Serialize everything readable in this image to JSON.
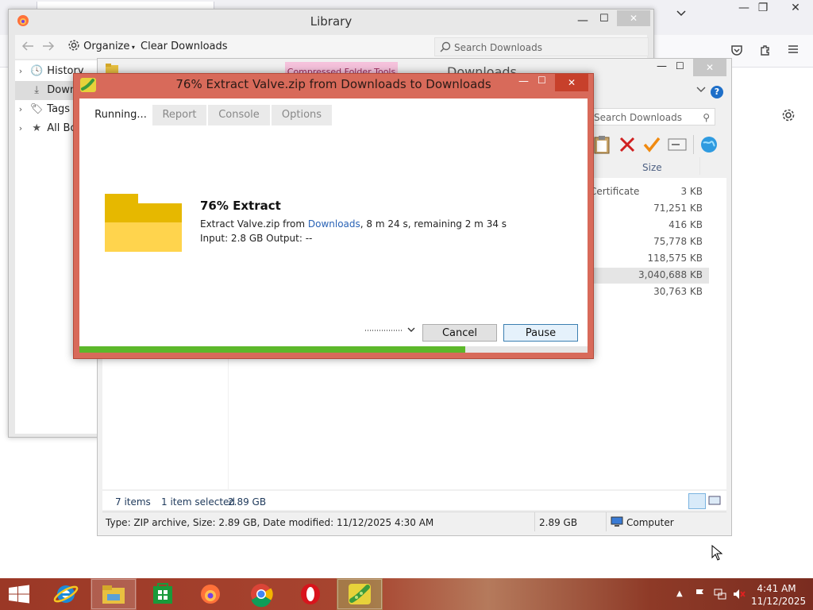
{
  "firefox": {
    "window_controls": [
      "—",
      "❐",
      "✕"
    ]
  },
  "library": {
    "title": "Library",
    "toolbar": {
      "organize_label": "Organize",
      "clear_label": "Clear Downloads",
      "search_placeholder": "Search Downloads"
    },
    "sidebar": {
      "items": [
        {
          "label": "History",
          "icon": "clock-icon"
        },
        {
          "label": "Downloads",
          "icon": "download-icon"
        },
        {
          "label": "Tags",
          "icon": "tag-icon"
        },
        {
          "label": "All Bookmarks",
          "icon": "star-icon"
        }
      ]
    }
  },
  "explorer": {
    "title": "Downloads",
    "ribbon_context": "Compressed Folder Tools",
    "search_placeholder": "Search Downloads",
    "column_size": "Size",
    "rows": [
      {
        "type": "Certificate",
        "size": "3 KB"
      },
      {
        "type": "",
        "size": "71,251 KB"
      },
      {
        "type": "",
        "size": "416 KB"
      },
      {
        "type": "",
        "size": "75,778 KB"
      },
      {
        "type": "",
        "size": "118,575 KB"
      },
      {
        "type": "",
        "size": "3,040,688 KB"
      },
      {
        "type": "",
        "size": "30,763 KB"
      }
    ],
    "items_count": "7 items",
    "selected": "1 item selected",
    "selected_size": "2.89 GB",
    "status_details": "Type: ZIP archive, Size: 2.89 GB, Date modified: 11/12/2025 4:30 AM",
    "status_size": "2.89 GB",
    "status_location": "Computer"
  },
  "dialog": {
    "title": "76% Extract Valve.zip from Downloads  to Downloads",
    "tabs": [
      "Running...",
      "Report",
      "Console",
      "Options"
    ],
    "heading": "76% Extract",
    "line1_prefix": "Extract Valve.zip from ",
    "line1_link": "Downloads",
    "line1_suffix": ", 8 m 24 s, remaining 2 m 34 s",
    "line2": "Input: 2.8 GB Output: --",
    "cancel_label": "Cancel",
    "pause_label": "Pause",
    "progress_fraction": 0.76,
    "accent": "#5cb82a"
  },
  "taskbar": {
    "apps": [
      "start-icon",
      "internet-explorer-icon",
      "file-explorer-icon",
      "store-icon",
      "firefox-icon",
      "chrome-icon",
      "opera-icon",
      "extractor-app-icon"
    ],
    "time": "4:41 AM",
    "date": "11/12/2025"
  }
}
